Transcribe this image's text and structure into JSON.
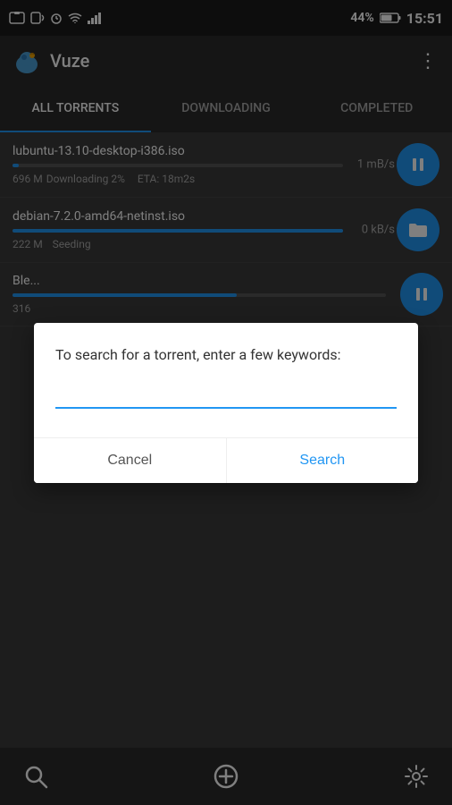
{
  "statusBar": {
    "batteryLevel": "44%",
    "time": "15:51",
    "icons": [
      "battery-icon",
      "wifi-icon",
      "signal-icon",
      "alarm-icon",
      "nfc-icon",
      "screenshot-icon"
    ]
  },
  "titleBar": {
    "appName": "Vuze",
    "menuIcon": "⋮"
  },
  "tabs": [
    {
      "id": "all",
      "label": "All Torrents",
      "active": true
    },
    {
      "id": "downloading",
      "label": "Downloading",
      "active": false
    },
    {
      "id": "completed",
      "label": "Completed",
      "active": false
    }
  ],
  "torrents": [
    {
      "name": "lubuntu-13.10-desktop-i386.iso",
      "size": "696 M",
      "status": "Downloading 2%",
      "eta": "ETA: 18m2s",
      "speed": "1 mB/s",
      "progress": 2,
      "action": "pause"
    },
    {
      "name": "debian-7.2.0-amd64-netinst.iso",
      "size": "222 M",
      "status": "Seeding",
      "eta": "",
      "speed": "0 kB/s",
      "progress": 100,
      "action": "folder"
    },
    {
      "name": "Ble",
      "size": "316",
      "status": "",
      "eta": "",
      "speed": "",
      "progress": 60,
      "action": "none"
    }
  ],
  "dialog": {
    "message": "To search for a torrent, enter a few keywords:",
    "inputPlaceholder": "",
    "cancelLabel": "Cancel",
    "searchLabel": "Search"
  },
  "bottomBar": {
    "searchIcon": "search-icon",
    "addIcon": "add-icon",
    "settingsIcon": "settings-icon"
  }
}
